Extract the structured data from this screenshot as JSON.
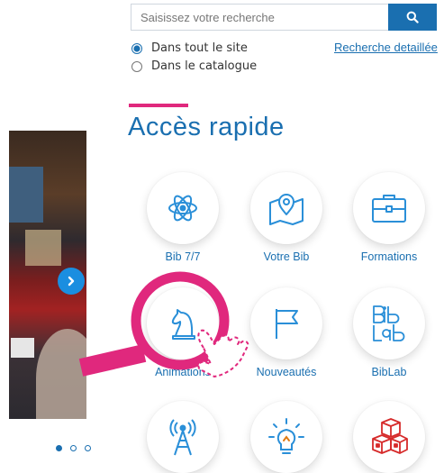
{
  "search": {
    "placeholder": "Saisissez votre recherche",
    "button_icon": "search-icon",
    "scope_options": [
      {
        "label": "Dans tout le site",
        "selected": true
      },
      {
        "label": "Dans le catalogue",
        "selected": false
      }
    ],
    "advanced_label": "Recherche detaillée"
  },
  "quick_access": {
    "title": "Accès rapide",
    "tiles": [
      {
        "label": "Bib 7/7",
        "icon": "atom-icon"
      },
      {
        "label": "Votre Bib",
        "icon": "map-pin-icon"
      },
      {
        "label": "Formations",
        "icon": "briefcase-icon"
      },
      {
        "label": "Animations",
        "icon": "chess-knight-icon"
      },
      {
        "label": "Nouveautés",
        "icon": "flag-icon"
      },
      {
        "label": "BibLab",
        "icon": "biblab-logo-icon"
      },
      {
        "label": "",
        "icon": "antenna-icon"
      },
      {
        "label": "",
        "icon": "lightbulb-icon"
      },
      {
        "label": "",
        "icon": "blocks-icon"
      }
    ]
  },
  "carousel": {
    "slide_count": 3,
    "active_index": 0
  },
  "colors": {
    "primary": "#1a6fb0",
    "accent": "#e0287d",
    "icon_blue": "#2a8fd8",
    "blocks_red": "#d62a2a"
  }
}
